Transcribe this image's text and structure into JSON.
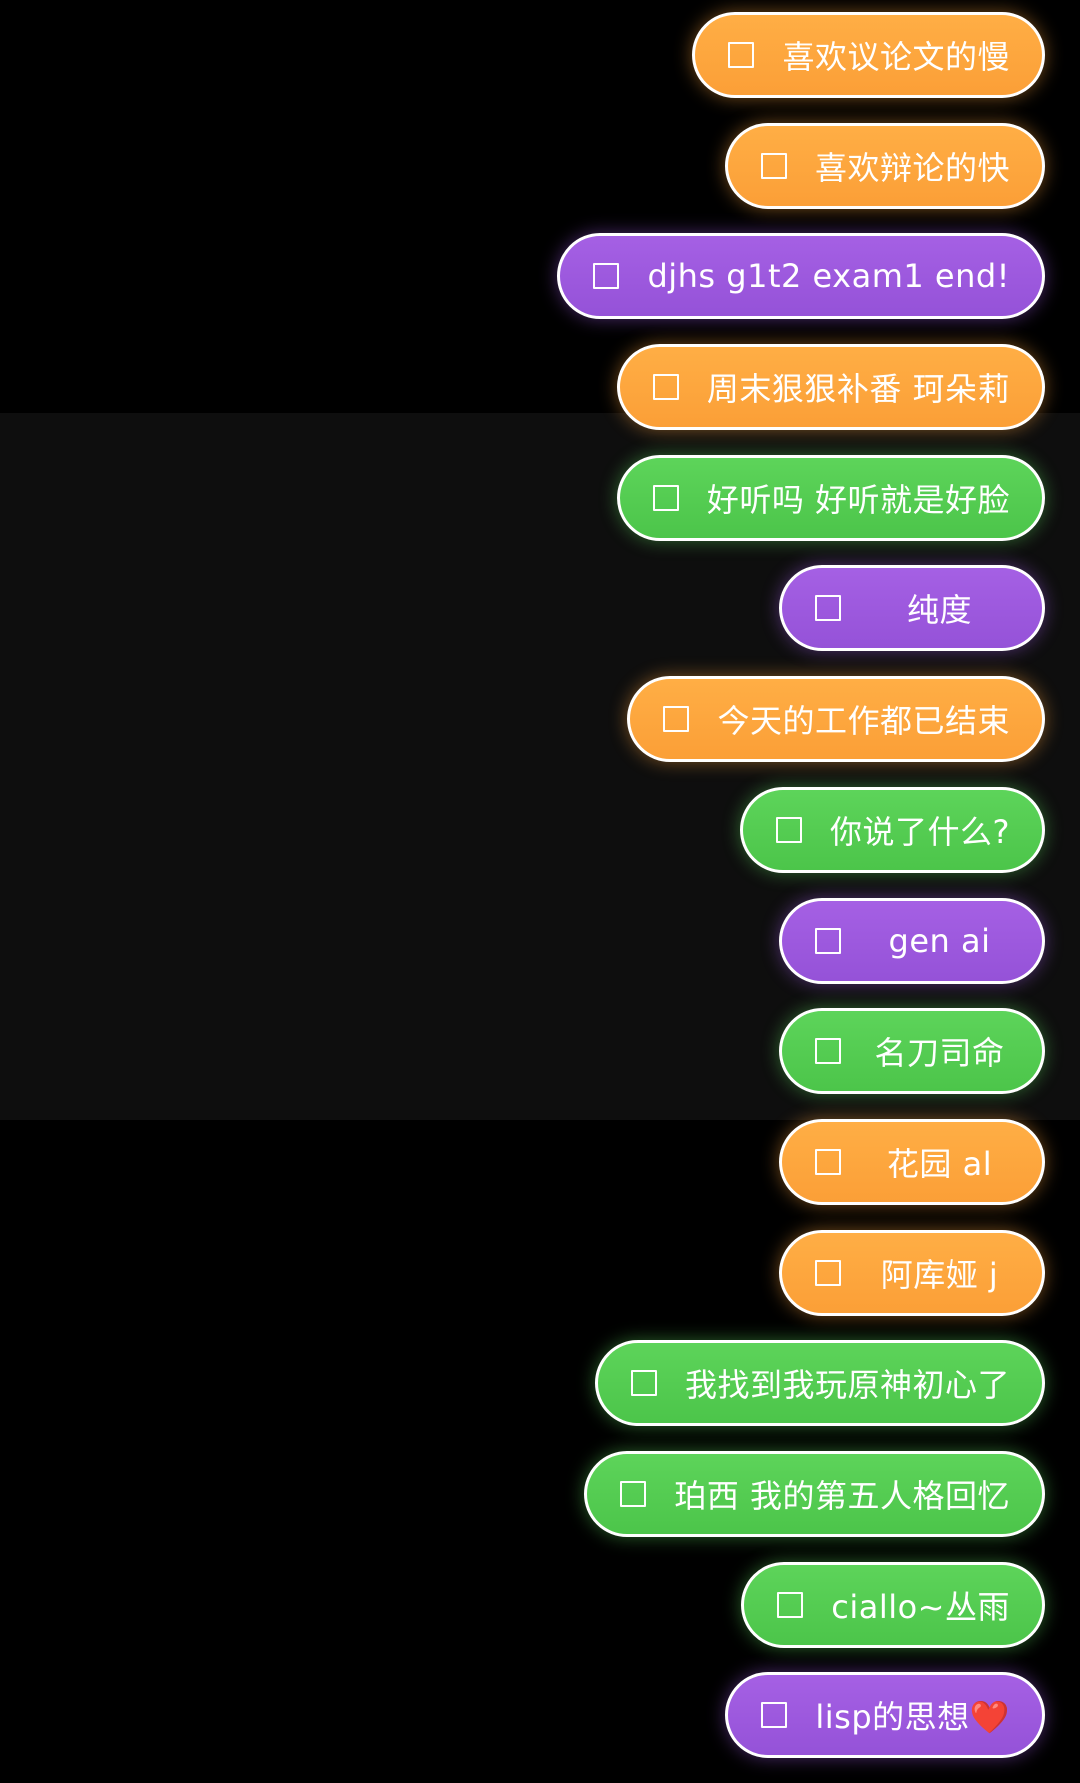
{
  "colors": {
    "background": "#000000",
    "band": "#0e0e0e",
    "orange": "#fca43c",
    "purple": "#9d5ae0",
    "green": "#55cd52",
    "outline": "#ffffff"
  },
  "icons": {
    "checkbox": "empty-square-checkbox-icon"
  },
  "todos": [
    {
      "label": "喜欢议论文的慢",
      "color": "orange",
      "checked": false
    },
    {
      "label": "喜欢辩论的快",
      "color": "orange",
      "checked": false
    },
    {
      "label": "djhs g1t2 exam1 end!",
      "color": "purple",
      "checked": false
    },
    {
      "label": "周末狠狠补番 珂朵莉",
      "color": "orange",
      "checked": false
    },
    {
      "label": "好听吗 好听就是好脸",
      "color": "green",
      "checked": false
    },
    {
      "label": "纯度",
      "color": "purple",
      "checked": false
    },
    {
      "label": "今天的工作都已结束",
      "color": "orange",
      "checked": false
    },
    {
      "label": "你说了什么?",
      "color": "green",
      "checked": false
    },
    {
      "label": "gen ai",
      "color": "purple",
      "checked": false
    },
    {
      "label": "名刀司命",
      "color": "green",
      "checked": false
    },
    {
      "label": "花园 al",
      "color": "orange",
      "checked": false
    },
    {
      "label": "阿库娅 j",
      "color": "orange",
      "checked": false
    },
    {
      "label": "我找到我玩原神初心了",
      "color": "green",
      "checked": false
    },
    {
      "label": "珀西 我的第五人格回忆",
      "color": "green",
      "checked": false
    },
    {
      "label": "ciallo~丛雨",
      "color": "green",
      "checked": false
    },
    {
      "label": "lisp的思想❤️",
      "color": "purple",
      "checked": false
    }
  ]
}
